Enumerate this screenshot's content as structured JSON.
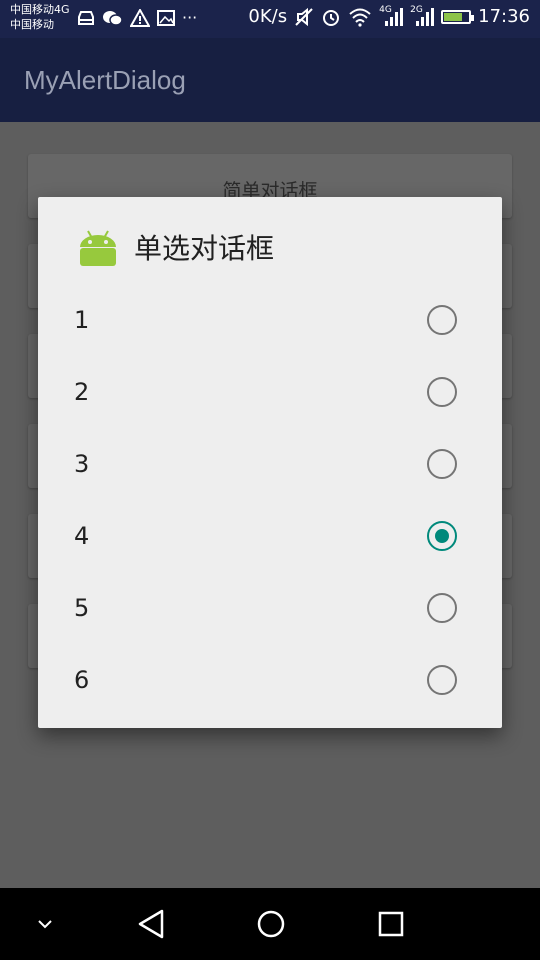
{
  "status_bar": {
    "carrier1": "中国移动4G",
    "carrier2": "中国移动",
    "icons": [
      "car-icon",
      "wechat-icon",
      "warning-icon",
      "image-icon",
      "more-icon"
    ],
    "net_speed": "0K/s",
    "signal_labels": [
      "4G",
      "2G"
    ],
    "time": "17:36"
  },
  "app_bar": {
    "title": "MyAlertDialog"
  },
  "background": {
    "first_button_label": "简单对话框"
  },
  "dialog": {
    "title": "单选对话框",
    "icon": "android-icon",
    "options": [
      {
        "label": "1",
        "checked": false
      },
      {
        "label": "2",
        "checked": false
      },
      {
        "label": "3",
        "checked": false
      },
      {
        "label": "4",
        "checked": true
      },
      {
        "label": "5",
        "checked": false
      },
      {
        "label": "6",
        "checked": false
      }
    ],
    "accent_color": "#00897b"
  },
  "nav_bar": {
    "items": [
      "chevron-down-icon",
      "back-icon",
      "home-icon",
      "recents-icon"
    ]
  }
}
